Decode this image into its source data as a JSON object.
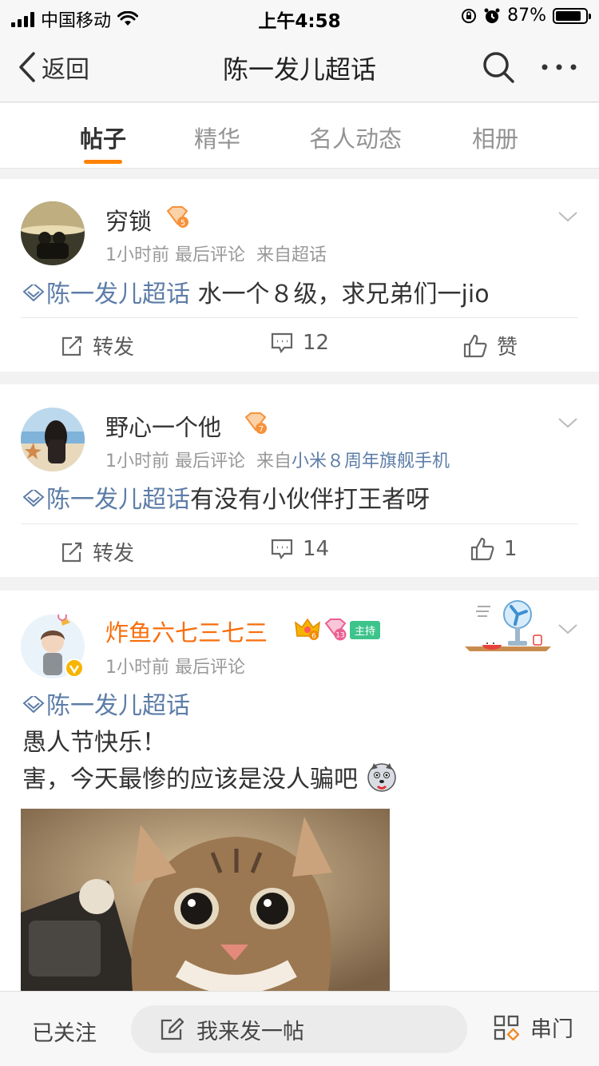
{
  "status_bar": {
    "carrier": "中国移动",
    "time": "上午4:58",
    "battery": "87%",
    "battery_level": 0.87
  },
  "nav": {
    "back_label": "返回",
    "title": "陈一发儿超话"
  },
  "tabs": [
    "帖子",
    "精华",
    "名人动态",
    "相册"
  ],
  "posts": [
    {
      "user": "穷锁",
      "level": "5",
      "meta": "1小时前 最后评论",
      "from_label": "来自超话",
      "topic": "陈一发儿超话",
      "text": " 水一个８级，求兄弟们一jio",
      "repost_label": "转发",
      "comments": "12",
      "likes": "赞"
    },
    {
      "user": "野心一个他",
      "level": "7",
      "meta": "1小时前 最后评论",
      "from_prefix": "来自",
      "from_source": "小米８周年旗舰手机",
      "topic": "陈一发儿超话",
      "text": "有没有小伙伴打王者呀",
      "repost_label": "转发",
      "comments": "14",
      "likes": "1"
    },
    {
      "user": "炸鱼六七三七三",
      "crown_level": "6",
      "level": "13",
      "host_badge": "主持",
      "meta": "1小时前 最后评论",
      "topic": "陈一发儿超话",
      "line1": "愚人节快乐！",
      "line2": "害，今天最惨的应该是没人骗吧"
    }
  ],
  "bottom_bar": {
    "follow_label": "已关注",
    "post_label": "我来发一帖",
    "door_label": "串门"
  },
  "colors": {
    "accent": "#ff8200",
    "link": "#5d7da8",
    "vip_name": "#f86e0b",
    "host_badge": "#3ec48b"
  }
}
